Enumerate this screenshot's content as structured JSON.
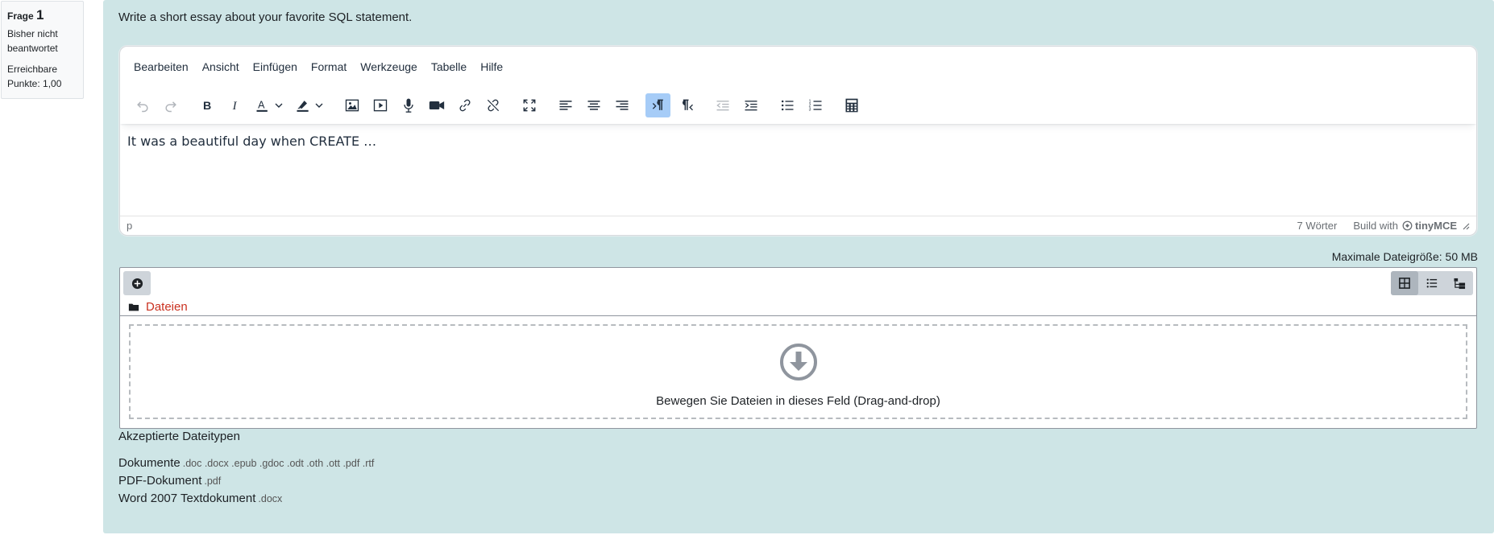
{
  "question_info": {
    "prefix": "Frage",
    "number": "1",
    "state": "Bisher nicht beantwortet",
    "grade": "Erreichbare Punkte: 1,00"
  },
  "question_text": "Write a short essay about your favorite SQL statement.",
  "editor": {
    "menu": [
      "Bearbeiten",
      "Ansicht",
      "Einfügen",
      "Format",
      "Werkzeuge",
      "Tabelle",
      "Hilfe"
    ],
    "content": "It was a beautiful day when CREATE …",
    "status_path": "p",
    "word_count": "7 Wörter",
    "build_with": "Build with",
    "brand": "tinyMCE"
  },
  "max_file_size": "Maximale Dateigröße: 50 MB",
  "filemanager": {
    "folder_label": "Dateien",
    "drop_text": "Bewegen Sie Dateien in dieses Feld (Drag-and-drop)"
  },
  "accepted": {
    "title": "Akzeptierte Dateitypen",
    "types": [
      {
        "name": "Dokumente",
        "ext": ".doc .docx .epub .gdoc .odt .oth .ott .pdf .rtf"
      },
      {
        "name": "PDF-Dokument",
        "ext": ".pdf"
      },
      {
        "name": "Word 2007 Textdokument",
        "ext": ".docx"
      }
    ]
  },
  "colors": {
    "panel_bg": "#cee5e6",
    "folder_link": "#ca3120",
    "active_button": "#a6ccf7"
  }
}
